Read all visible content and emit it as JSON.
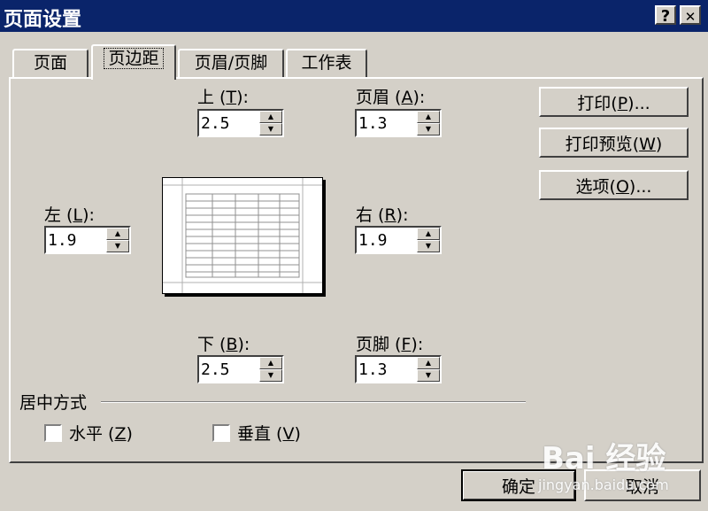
{
  "window": {
    "title": "页面设置",
    "help_label": "?",
    "close_label": "✕"
  },
  "tabs": [
    {
      "label": "页面",
      "active": false
    },
    {
      "label": "页边距",
      "active": true
    },
    {
      "label": "页眉/页脚",
      "active": false
    },
    {
      "label": "工作表",
      "active": false
    }
  ],
  "margins": {
    "top": {
      "label": "上",
      "key": "T",
      "value": "2.5"
    },
    "header": {
      "label": "页眉",
      "key": "A",
      "value": "1.3"
    },
    "left": {
      "label": "左",
      "key": "L",
      "value": "1.9"
    },
    "right": {
      "label": "右",
      "key": "R",
      "value": "1.9"
    },
    "bottom": {
      "label": "下",
      "key": "B",
      "value": "2.5"
    },
    "footer": {
      "label": "页脚",
      "key": "F",
      "value": "1.3"
    }
  },
  "centering": {
    "group_label": "居中方式",
    "horizontal": {
      "label": "水平",
      "key": "Z",
      "checked": false
    },
    "vertical": {
      "label": "垂直",
      "key": "V",
      "checked": false
    }
  },
  "side_buttons": {
    "print": {
      "label": "打印",
      "key": "P",
      "suffix": "..."
    },
    "preview": {
      "label": "打印预览",
      "key": "W",
      "suffix": ""
    },
    "options": {
      "label": "选项",
      "key": "O",
      "suffix": "..."
    }
  },
  "footer_buttons": {
    "ok": "确定",
    "cancel": "取消"
  },
  "watermark": {
    "brand": "Bai 经验",
    "url": "jingyan.baidu.com"
  }
}
